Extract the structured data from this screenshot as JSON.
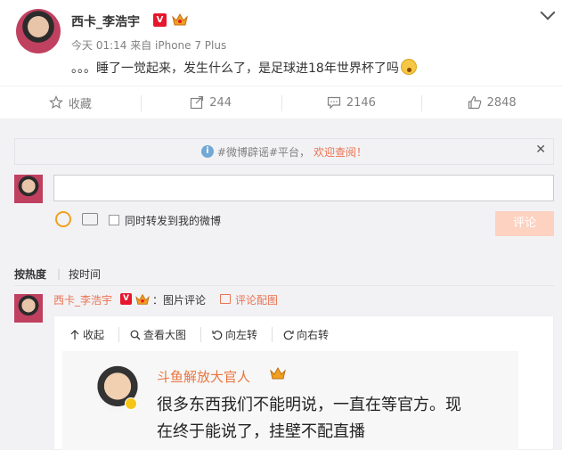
{
  "post": {
    "username": "西卡_李浩宇",
    "verified_badge": "V",
    "meta": "今天 01:14 来自 iPhone 7 Plus",
    "content": "。。。睡了一觉起来，发生什么了，是足球进18年世界杯了吗"
  },
  "actions": {
    "favorite": "收藏",
    "repost_count": "244",
    "comment_count": "2146",
    "like_count": "2848"
  },
  "notice": {
    "prefix": "#微博辟谣#平台，",
    "link": "欢迎查阅！"
  },
  "composer": {
    "input_value": "",
    "repost_label": "同时转发到我的微博",
    "submit_label": "评论"
  },
  "sort": {
    "hot": "按热度",
    "divider": "|",
    "time": "按时间"
  },
  "comment": {
    "username": "西卡_李浩宇",
    "verified_badge": "V",
    "text": "：图片评论",
    "tag": "评论配图"
  },
  "viewer": {
    "collapse": "收起",
    "view_large": "查看大图",
    "rotate_left": "向左转",
    "rotate_right": "向右转"
  },
  "image": {
    "name": "斗鱼解放大官人",
    "line1": "很多东西我们不能明说，一直在等官方。现",
    "line2": "在终于能说了，挂壁不配直播"
  },
  "colors": {
    "accent": "#eb7350",
    "verified": "#e6162d",
    "submit_disabled": "#fdd2c0"
  }
}
